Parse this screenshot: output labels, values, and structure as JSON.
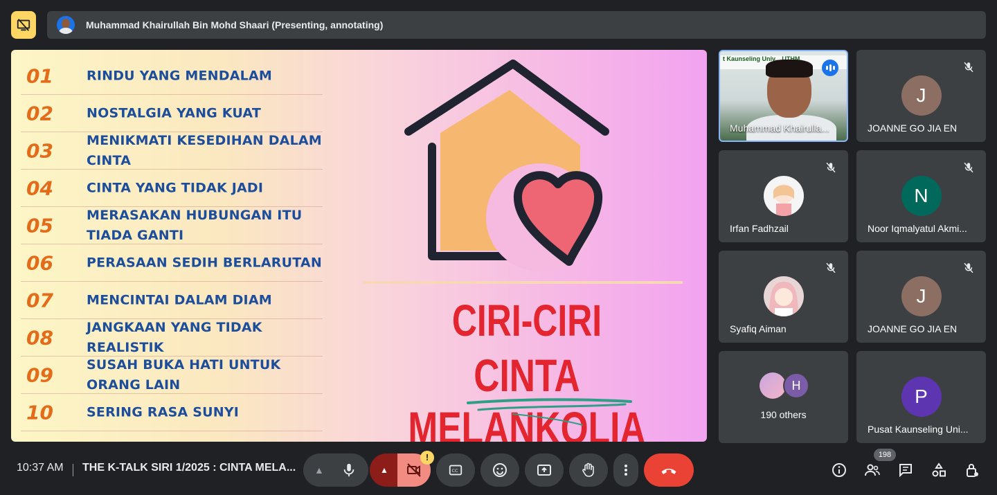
{
  "presenter": {
    "name": "Muhammad Khairullah Bin Mohd Shaari (Presenting, annotating)"
  },
  "slide": {
    "items": [
      {
        "num": "01",
        "text": "RINDU YANG MENDALAM"
      },
      {
        "num": "02",
        "text": "NOSTALGIA YANG KUAT"
      },
      {
        "num": "03",
        "text": "MENIKMATI KESEDIHAN DALAM CINTA"
      },
      {
        "num": "04",
        "text": "CINTA YANG TIDAK JADI"
      },
      {
        "num": "05",
        "text": "MERASAKAN HUBUNGAN ITU TIADA GANTI"
      },
      {
        "num": "06",
        "text": "PERASAAN SEDIH BERLARUTAN"
      },
      {
        "num": "07",
        "text": "MENCINTAI DALAM DIAM"
      },
      {
        "num": "08",
        "text": "JANGKAAN YANG TIDAK REALISTIK"
      },
      {
        "num": "09",
        "text": "SUSAH BUKA HATI UNTUK ORANG LAIN"
      },
      {
        "num": "10",
        "text": "SERING RASA SUNYI"
      }
    ],
    "title_line1": "CIRI-CIRI",
    "title_line2": "CINTA MELANKOLIA"
  },
  "participants": {
    "active": {
      "name": "Muhammad Khairulla...",
      "banner": "t Kaunseling Univ... UTHM"
    },
    "tiles": [
      {
        "name": "JOANNE GO JIA EN",
        "initial": "J",
        "color": "#8d6e63"
      },
      {
        "name": "Irfan Fadhzail",
        "initial": "",
        "color": "#f5f5f5"
      },
      {
        "name": "Noor Iqmalyatul Akmi...",
        "initial": "N",
        "color": "#00695c"
      },
      {
        "name": "Syafiq Aiman",
        "initial": "",
        "color": "#e8d6d6"
      },
      {
        "name": "JOANNE GO JIA EN",
        "initial": "J",
        "color": "#8d6e63"
      },
      {
        "name": "Pusat Kaunseling Uni...",
        "initial": "P",
        "color": "#5e35b1"
      }
    ],
    "others": {
      "label": "190 others",
      "initial": "H",
      "color": "#7b5ca8"
    }
  },
  "bottom": {
    "time": "10:37 AM",
    "meeting_title": "THE K-TALK SIRI 1/2025 : CINTA MELA...",
    "people_count": "198",
    "warning": "!"
  },
  "colors": {
    "bg": "#202124",
    "tile": "#3c4043",
    "hangup": "#ea4335",
    "present": "#fdd663",
    "accent": "#8ab4f8"
  }
}
